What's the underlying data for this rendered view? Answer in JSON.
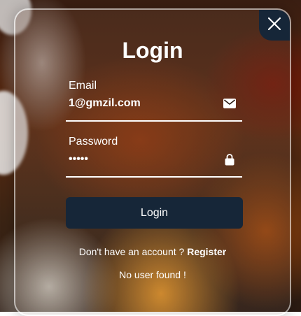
{
  "login": {
    "title": "Login",
    "close_icon": "close-icon",
    "email": {
      "label": "Email",
      "value": "1@gmzil.com",
      "icon": "mail-icon"
    },
    "password": {
      "label": "Password",
      "value": "•••••",
      "icon": "lock-icon"
    },
    "submit_label": "Login",
    "register_prompt": "Don't have an account ? ",
    "register_link": "Register",
    "error_message": "No user found !"
  },
  "colors": {
    "button_bg": "#162638",
    "text": "#ffffff",
    "card_border": "rgba(255,255,255,0.55)"
  }
}
